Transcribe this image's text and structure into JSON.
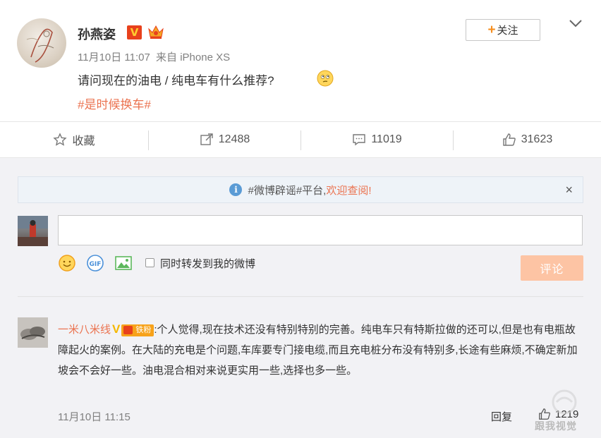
{
  "post": {
    "author": "孙燕姿",
    "verified_badge": "V",
    "time": "11月10日 11:07",
    "source": "来自 iPhone XS",
    "text": "请问现在的油电 / 纯电车有什么推荐?",
    "hashtag": "#是时候换车#",
    "follow_label": "关注",
    "follow_plus": "+",
    "icons": [
      "verified-v-icon",
      "crown-icon",
      "thinking-emoji-icon",
      "chevron-down-icon"
    ]
  },
  "actions": {
    "favorite_label": "收藏",
    "repost_count": "12488",
    "comment_count": "11019",
    "like_count": "31623"
  },
  "notice": {
    "tag": "#微博辟谣#平台,",
    "welcome": "欢迎查阅!",
    "close": "×",
    "info": "i"
  },
  "composer": {
    "input_value": "",
    "repost_label": "同时转发到我的微博",
    "submit_label": "评论",
    "tools": [
      "emoji-icon",
      "gif-icon",
      "image-icon"
    ]
  },
  "comment": {
    "user": "一米八米线",
    "v": "V",
    "fan_badge": "铁粉",
    "text": ":个人觉得,现在技术还没有特别特别的完善。纯电车只有特斯拉做的还可以,但是也有电瓶故障起火的案例。在大陆的充电是个问题,车库要专门接电缆,而且充电桩分布没有特别多,长途有些麻烦,不确定新加坡会不会好一些。油电混合相对来说更实用一些,选择也多一些。",
    "time": "11月10日 11:15",
    "reply_label": "回复",
    "like_count": "1219"
  },
  "watermark": "跟我视觉",
  "colors": {
    "accent_orange": "#eb7350",
    "submit_bg": "#fdc4a4",
    "verified_red": "#e8411c",
    "comment_bg": "#f2f2f5"
  }
}
